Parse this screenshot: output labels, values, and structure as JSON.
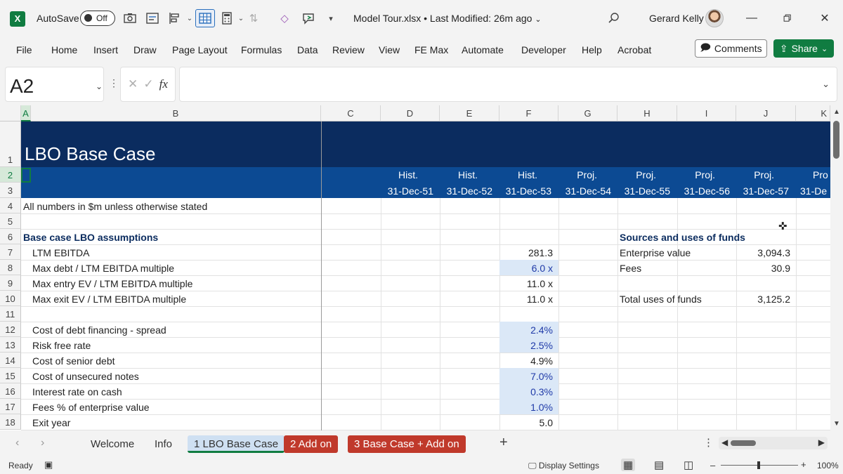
{
  "titlebar": {
    "autosave_label": "AutoSave",
    "autosave_state": "Off",
    "document_title": "Model Tour.xlsx • Last Modified: 26m ago",
    "user_name": "Gerard Kelly"
  },
  "ribbon": {
    "tabs": [
      "File",
      "Home",
      "Insert",
      "Draw",
      "Page Layout",
      "Formulas",
      "Data",
      "Review",
      "View",
      "FE Max",
      "Automate",
      "Developer",
      "Help",
      "Acrobat"
    ],
    "comments_label": "Comments",
    "share_label": "Share"
  },
  "formula_bar": {
    "name_box": "A2",
    "fx_label": "fx",
    "formula": ""
  },
  "columns": [
    "A",
    "B",
    "C",
    "D",
    "E",
    "F",
    "G",
    "H",
    "I",
    "J",
    "K"
  ],
  "rows": [
    "1",
    "2",
    "3",
    "4",
    "5",
    "6",
    "7",
    "8",
    "9",
    "10",
    "11",
    "12",
    "13",
    "14",
    "15",
    "16",
    "17",
    "18"
  ],
  "sheet": {
    "title": "LBO Base Case",
    "period_types": [
      "Hist.",
      "Hist.",
      "Hist.",
      "Proj.",
      "Proj.",
      "Proj.",
      "Proj.",
      "Pro"
    ],
    "period_dates": [
      "31-Dec-51",
      "31-Dec-52",
      "31-Dec-53",
      "31-Dec-54",
      "31-Dec-55",
      "31-Dec-56",
      "31-Dec-57",
      "31-De"
    ],
    "note": "All numbers in $m unless otherwise stated",
    "assumptions_heading": "Base case LBO assumptions",
    "assumptions": [
      {
        "label": "LTM EBITDA",
        "value": "281.3",
        "input": false
      },
      {
        "label": "Max debt / LTM EBITDA multiple",
        "value": "6.0 x",
        "input": true
      },
      {
        "label": "Max entry EV / LTM EBITDA multiple",
        "value": "11.0 x",
        "input": false
      },
      {
        "label": "Max exit EV / LTM EBITDA multiple",
        "value": "11.0 x",
        "input": false
      },
      {
        "label": "",
        "value": "",
        "input": false
      },
      {
        "label": "Cost of debt financing - spread",
        "value": "2.4%",
        "input": true
      },
      {
        "label": "Risk free rate",
        "value": "2.5%",
        "input": true
      },
      {
        "label": "Cost of senior debt",
        "value": "4.9%",
        "input": false
      },
      {
        "label": "Cost of unsecured notes",
        "value": "7.0%",
        "input": true
      },
      {
        "label": "Interest rate on cash",
        "value": "0.3%",
        "input": true
      },
      {
        "label": "Fees % of enterprise value",
        "value": "1.0%",
        "input": true
      },
      {
        "label": "Exit year",
        "value": "5.0",
        "input": false
      }
    ],
    "sources_heading": "Sources and uses of funds",
    "sources": [
      {
        "label": "Enterprise value",
        "value": "3,094.3"
      },
      {
        "label": "Fees",
        "value": "30.9"
      },
      {
        "label": "",
        "value": ""
      },
      {
        "label": "Total uses of funds",
        "value": "3,125.2"
      }
    ]
  },
  "sheet_tabs": [
    "Welcome",
    "Info",
    "1 LBO Base Case",
    "2 Add on",
    "3 Base Case + Add on"
  ],
  "status": {
    "ready": "Ready",
    "display_settings": "Display Settings",
    "zoom": "100%"
  },
  "colors": {
    "excel_green": "#107c41",
    "title_band": "#0b2c5f",
    "header_band": "#0c4a93",
    "input_shade": "#dbe8f7",
    "input_text": "#1f3aa8",
    "red_tab": "#c0392b"
  }
}
